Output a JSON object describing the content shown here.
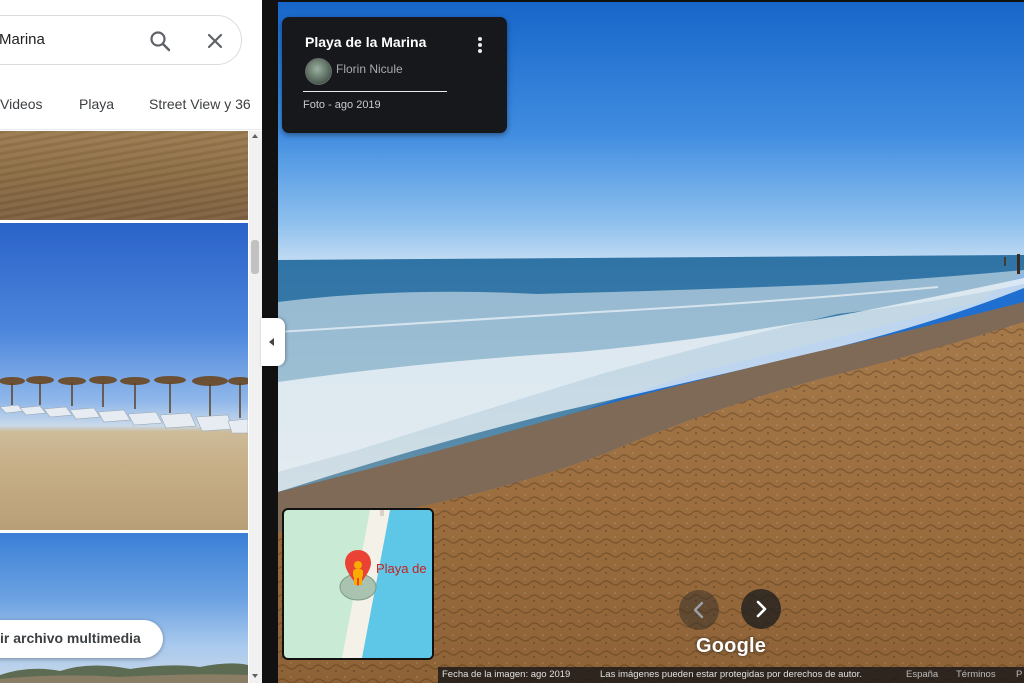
{
  "search": {
    "value": "Marina"
  },
  "tabs": [
    {
      "label": "Videos"
    },
    {
      "label": "Playa"
    },
    {
      "label": "Street View y 36"
    }
  ],
  "gallery": {
    "add_media_label": "ir archivo multimedia"
  },
  "streetview": {
    "title": "Playa de la Marina",
    "author": "Florin Nicule",
    "photo_date": "Foto - ago 2019",
    "map_label": "Playa de",
    "logo": "Google"
  },
  "footer": {
    "image_date": "Fecha de la imagen: ago 2019",
    "copyright": "Las imágenes pueden estar protegidas por derechos de autor.",
    "country": "España",
    "terms": "Términos",
    "extra": "P"
  },
  "icons": {
    "search": "search-icon",
    "close": "close-icon",
    "menu": "more-vert-icon",
    "prev": "chevron-left-icon",
    "next": "chevron-right-icon",
    "pegman": "pegman-icon",
    "collapse": "collapse-left-icon"
  },
  "colors": {
    "panel_bg": "#ffffff",
    "card_bg": "#17181b",
    "pin_red": "#ea4335",
    "pegman_yellow": "#f9ab00",
    "water_blue": "#5ec6e6",
    "map_green": "#c9ead5"
  }
}
